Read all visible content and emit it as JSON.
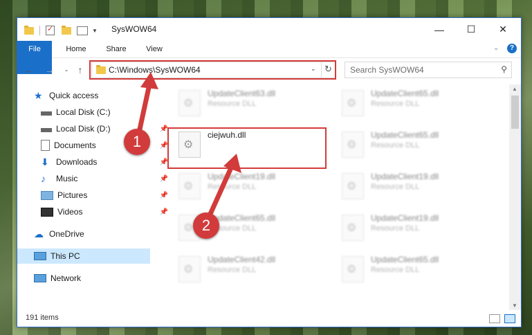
{
  "window": {
    "title": "SysWOW64"
  },
  "ribbon": {
    "tabs": [
      "File",
      "Home",
      "Share",
      "View"
    ]
  },
  "address": {
    "path": "C:\\Windows\\SysWOW64",
    "search_placeholder": "Search SysWOW64"
  },
  "sidebar": {
    "items": [
      {
        "label": "Quick access",
        "pinned": false
      },
      {
        "label": "Local Disk (C:)",
        "pinned": false
      },
      {
        "label": "Local Disk (D:)",
        "pinned": true
      },
      {
        "label": "Documents",
        "pinned": true
      },
      {
        "label": "Downloads",
        "pinned": true
      },
      {
        "label": "Music",
        "pinned": true
      },
      {
        "label": "Pictures",
        "pinned": true
      },
      {
        "label": "Videos",
        "pinned": true
      },
      {
        "label": "OneDrive",
        "pinned": false
      },
      {
        "label": "This PC",
        "pinned": false
      },
      {
        "label": "Network",
        "pinned": false
      }
    ]
  },
  "files": {
    "left": [
      {
        "name": "UpdateClient63.dll",
        "type": "Resource DLL"
      },
      {
        "name": "ciejwuh.dll",
        "type": ""
      },
      {
        "name": "UpdateClient19.dll",
        "type": "Resource DLL"
      },
      {
        "name": "UpdateClient65.dll",
        "type": "Resource DLL"
      },
      {
        "name": "UpdateClient42.dll",
        "type": "Resource DLL"
      }
    ],
    "right": [
      {
        "name": "UpdateClient65.dll",
        "type": "Resource DLL"
      },
      {
        "name": "UpdateClient65.dll",
        "type": "Resource DLL"
      },
      {
        "name": "UpdateClient19.dll",
        "type": "Resource DLL"
      },
      {
        "name": "UpdateClient19.dll",
        "type": "Resource DLL"
      },
      {
        "name": "UpdateClient65.dll",
        "type": "Resource DLL"
      }
    ]
  },
  "status": {
    "count": "191 items"
  },
  "annotations": [
    "1",
    "2"
  ],
  "colors": {
    "accent": "#1a6fc9",
    "highlight": "#d43a3a",
    "selected": "#cce8ff"
  }
}
